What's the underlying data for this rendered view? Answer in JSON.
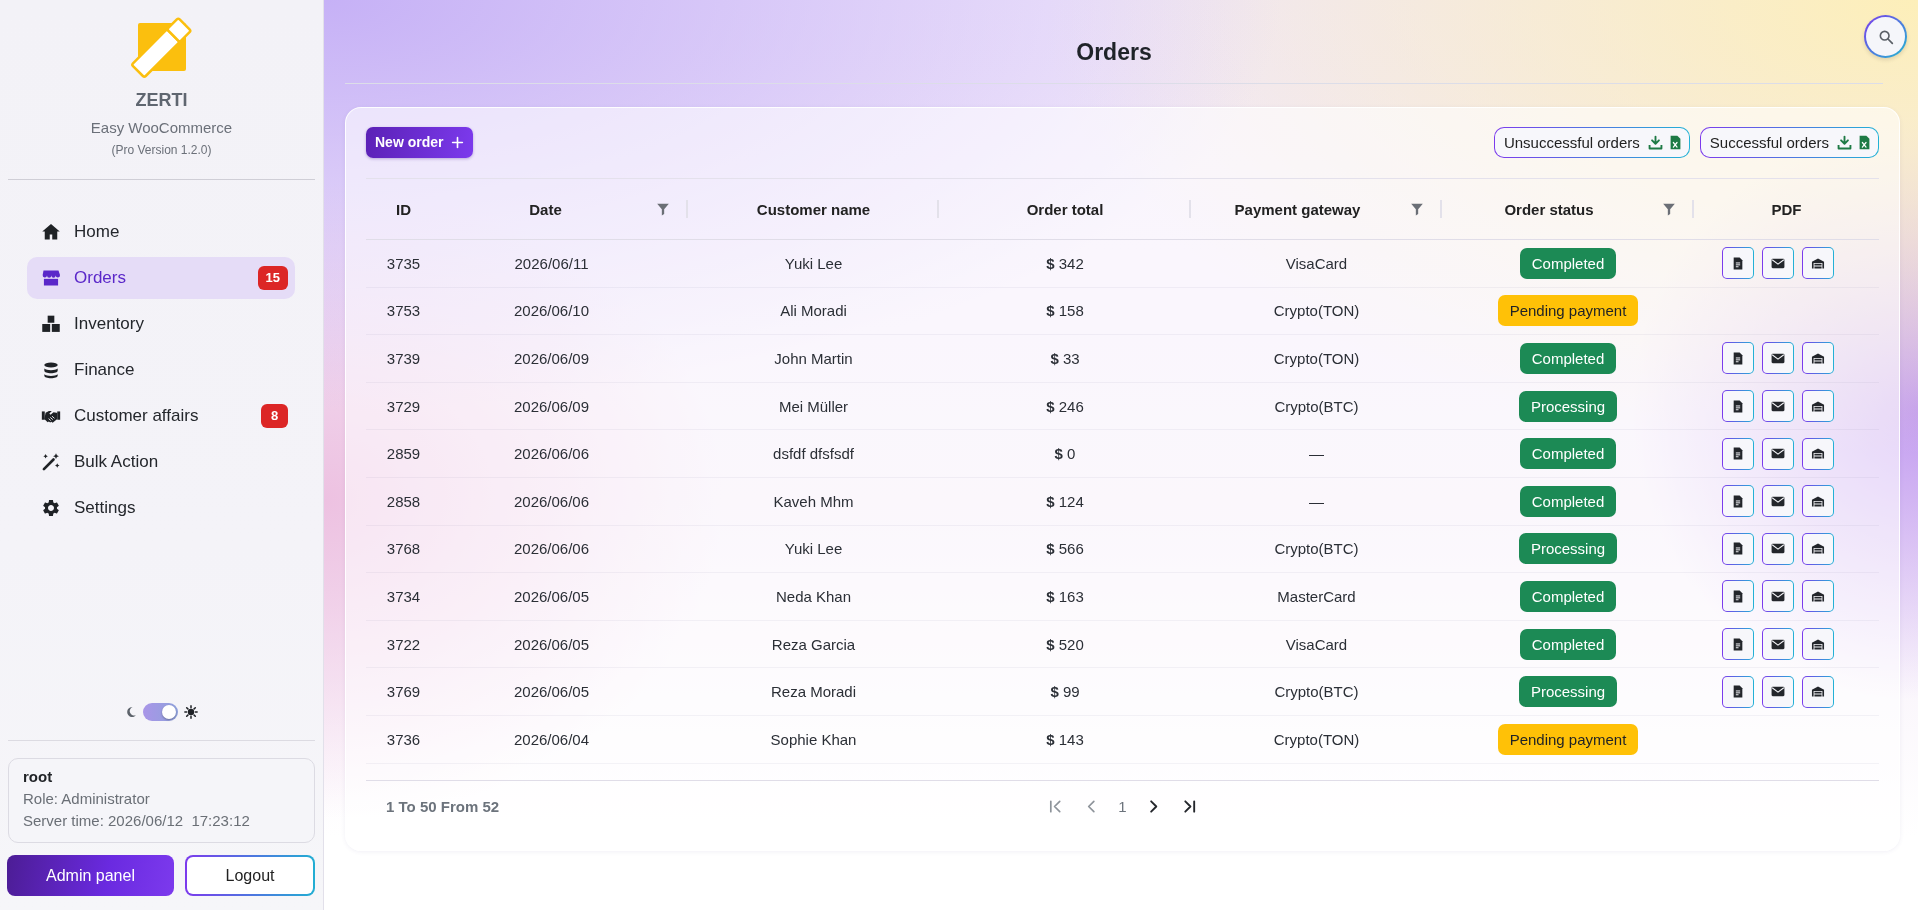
{
  "sidebar": {
    "brand": {
      "name": "ZERTI",
      "subtitle": "Easy WooCommerce",
      "version": "(Pro Version 1.2.0)"
    },
    "nav": [
      {
        "label": "Home",
        "selected": false
      },
      {
        "label": "Orders",
        "selected": true,
        "badge": "15"
      },
      {
        "label": "Inventory",
        "selected": false
      },
      {
        "label": "Finance",
        "selected": false
      },
      {
        "label": "Customer affairs",
        "selected": false,
        "badge": "8"
      },
      {
        "label": "Bulk Action",
        "selected": false
      },
      {
        "label": "Settings",
        "selected": false
      }
    ],
    "theme_toggle": {
      "on": true
    },
    "user": {
      "name": "root",
      "role": "Role: Administrator",
      "server_time": "Server time: 2026/06/12  17:23:12"
    },
    "buttons": [
      {
        "label": "Admin panel",
        "kind": "primary"
      },
      {
        "label": "Logout",
        "kind": "outline"
      }
    ]
  },
  "header": {
    "title": "Orders"
  },
  "orders": {
    "new_order_button": "New order",
    "exports": [
      {
        "label": "Unsuccessful orders"
      },
      {
        "label": "Successful orders"
      }
    ],
    "table": {
      "columns": [
        {
          "label": "ID",
          "filter": false
        },
        {
          "label": "Date",
          "filter": true
        },
        {
          "label": "Customer name",
          "filter": false
        },
        {
          "label": "Order total",
          "filter": false
        },
        {
          "label": "Payment gateway",
          "filter": true
        },
        {
          "label": "Order status",
          "filter": true
        },
        {
          "label": "PDF",
          "filter": false
        }
      ],
      "rows": [
        {
          "order_id": "3735",
          "date": "2026/06/11",
          "customer": "Yuki Lee",
          "total": "**$** 342",
          "gateway": "VisaCard",
          "status": {
            "label": "Completed",
            "kind": "success"
          },
          "pdf": true
        },
        {
          "order_id": "3753",
          "date": "2026/06/10",
          "customer": "Ali Moradi",
          "total": "**$** 158",
          "gateway": "Crypto(TON)",
          "status": {
            "label": "Pending payment",
            "kind": "warning"
          },
          "pdf": false
        },
        {
          "order_id": "3739",
          "date": "2026/06/09",
          "customer": "John Martin",
          "total": "**$** 33",
          "gateway": "Crypto(TON)",
          "status": {
            "label": "Completed",
            "kind": "success"
          },
          "pdf": true
        },
        {
          "order_id": "3729",
          "date": "2026/06/09",
          "customer": "Mei Müller",
          "total": "**$** 246",
          "gateway": "Crypto(BTC)",
          "status": {
            "label": "Processing",
            "kind": "success"
          },
          "pdf": true
        },
        {
          "order_id": "2859",
          "date": "2026/06/06",
          "customer": "dsfdf dfsfsdf",
          "total": "**$** 0",
          "gateway": "—",
          "status": {
            "label": "Completed",
            "kind": "success"
          },
          "pdf": true
        },
        {
          "order_id": "2858",
          "date": "2026/06/06",
          "customer": "Kaveh Mhm",
          "total": "**$** 124",
          "gateway": "—",
          "status": {
            "label": "Completed",
            "kind": "success"
          },
          "pdf": true
        },
        {
          "order_id": "3768",
          "date": "2026/06/06",
          "customer": "Yuki Lee",
          "total": "**$** 566",
          "gateway": "Crypto(BTC)",
          "status": {
            "label": "Processing",
            "kind": "success"
          },
          "pdf": true
        },
        {
          "order_id": "3734",
          "date": "2026/06/05",
          "customer": "Neda Khan",
          "total": "**$** 163",
          "gateway": "MasterCard",
          "status": {
            "label": "Completed",
            "kind": "success"
          },
          "pdf": true
        },
        {
          "order_id": "3722",
          "date": "2026/06/05",
          "customer": "Reza Garcia",
          "total": "**$** 520",
          "gateway": "VisaCard",
          "status": {
            "label": "Completed",
            "kind": "success"
          },
          "pdf": true
        },
        {
          "order_id": "3769",
          "date": "2026/06/05",
          "customer": "Reza Moradi",
          "total": "**$** 99",
          "gateway": "Crypto(BTC)",
          "status": {
            "label": "Processing",
            "kind": "success"
          },
          "pdf": true
        },
        {
          "order_id": "3736",
          "date": "2026/06/04",
          "customer": "Sophie Khan",
          "total": "**$** 143",
          "gateway": "Crypto(TON)",
          "status": {
            "label": "Pending payment",
            "kind": "warning"
          },
          "pdf": false
        }
      ]
    },
    "pagination": {
      "summary": "1 To 50 From 52",
      "page": "1",
      "back_disabled": true,
      "forward_disabled": false
    }
  }
}
